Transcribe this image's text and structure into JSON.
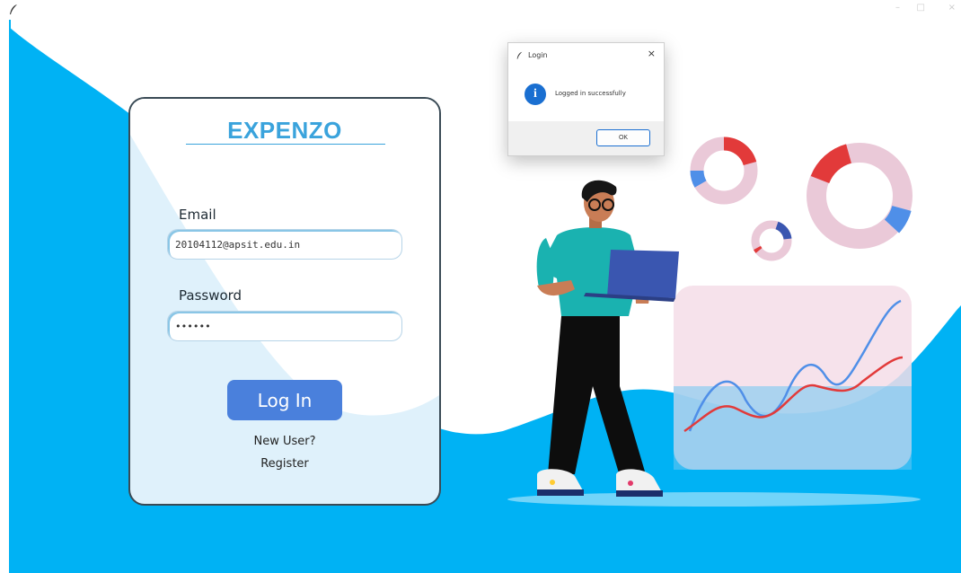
{
  "window": {
    "title": "",
    "controls": {
      "minimize": "–",
      "maximize": "□",
      "close": "×"
    },
    "icon": "feather-icon"
  },
  "login_card": {
    "brand": "EXPENZO",
    "email_label": "Email",
    "email_value": "20104112@apsit.edu.in",
    "password_label": "Password",
    "password_value": "••••••",
    "login_button": "Log In",
    "new_user_text": "New User?",
    "register_link": "Register"
  },
  "dialog": {
    "title": "Login",
    "message": "Logged in successfully",
    "ok_button": "OK",
    "close": "×",
    "info_icon_glyph": "i",
    "icon": "info-icon"
  },
  "colors": {
    "background_blue": "#00b2f4",
    "brand_blue": "#3aa3dc",
    "button_blue": "#4a80dc",
    "accent_red": "#e23a3a",
    "accent_pink": "#eac9d8"
  }
}
